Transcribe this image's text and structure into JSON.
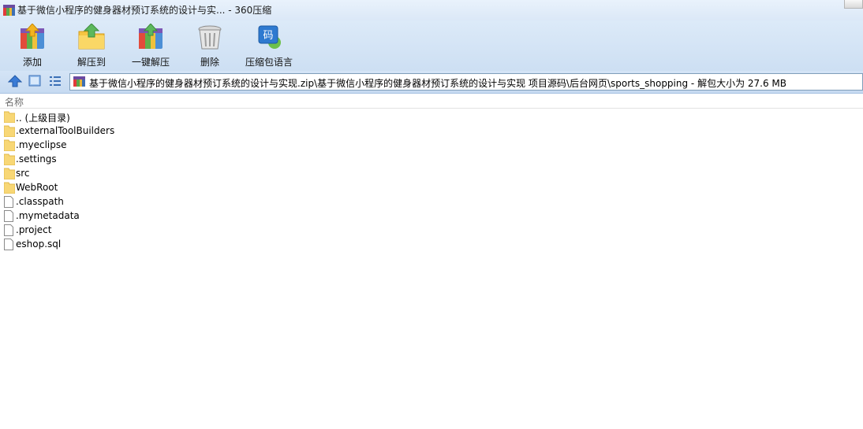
{
  "window": {
    "title": "基于微信小程序的健身器材预订系统的设计与实... - 360压缩",
    "icon": "archive-icon"
  },
  "toolbar": {
    "add_label": "添加",
    "extract_to_label": "解压到",
    "one_click_extract_label": "一键解压",
    "delete_label": "删除",
    "language_label": "压缩包语言"
  },
  "navigation": {
    "path": "基于微信小程序的健身器材预订系统的设计与实现.zip\\基于微信小程序的健身器材预订系统的设计与实现 项目源码\\后台网页\\sports_shopping - 解包大小为 27.6 MB"
  },
  "list": {
    "header": "名称",
    "items": [
      {
        "name": ".. (上级目录)",
        "type": "folder"
      },
      {
        "name": ".externalToolBuilders",
        "type": "folder"
      },
      {
        "name": ".myeclipse",
        "type": "folder"
      },
      {
        "name": ".settings",
        "type": "folder"
      },
      {
        "name": "src",
        "type": "folder"
      },
      {
        "name": "WebRoot",
        "type": "folder"
      },
      {
        "name": ".classpath",
        "type": "file"
      },
      {
        "name": ".mymetadata",
        "type": "file"
      },
      {
        "name": ".project",
        "type": "file"
      },
      {
        "name": "eshop.sql",
        "type": "file"
      }
    ]
  },
  "colors": {
    "toolbar_bg": "#cddff3",
    "folder": "#f8d775",
    "accent": "#3a7bd5"
  }
}
